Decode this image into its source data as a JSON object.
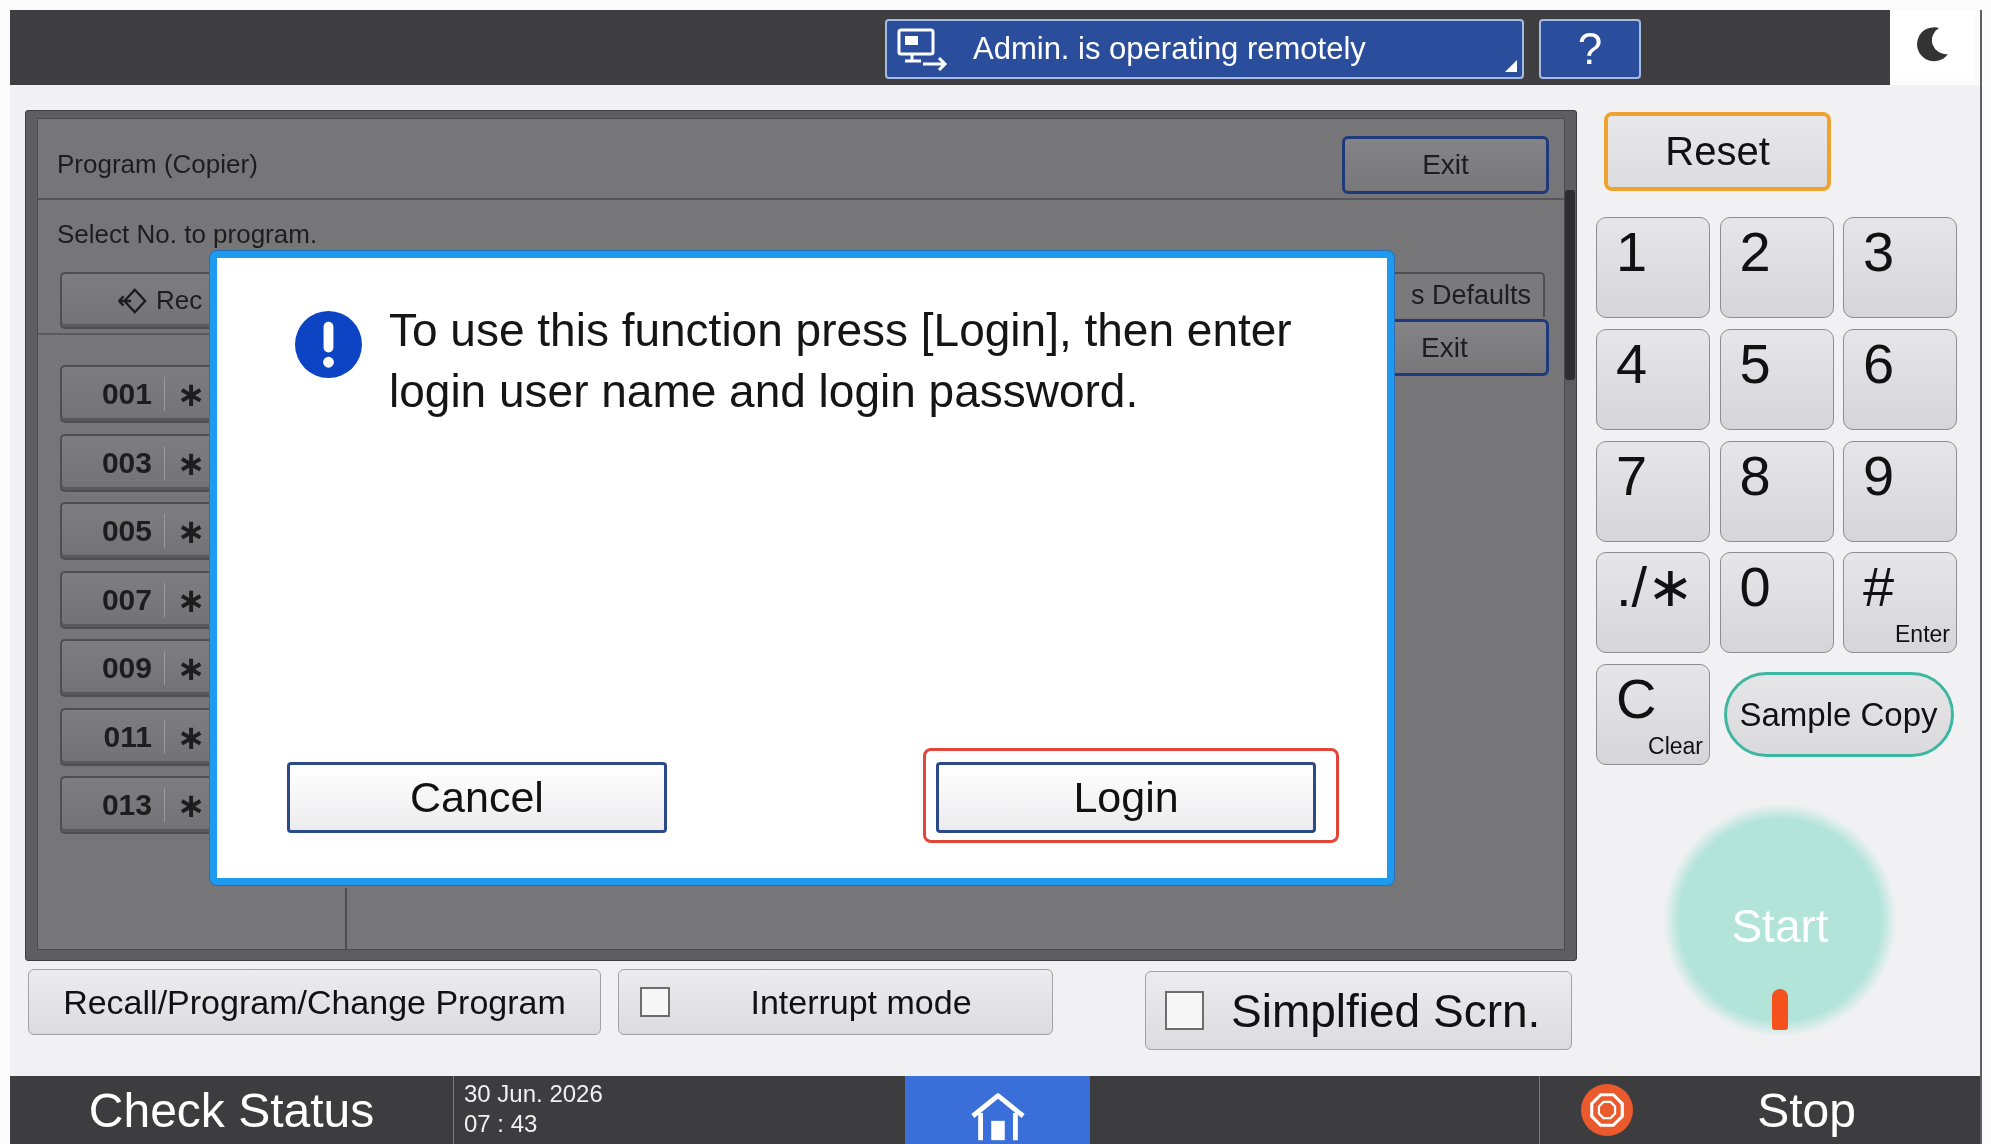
{
  "top_bar": {
    "remote_status": "Admin. is operating remotely",
    "help": "?"
  },
  "program_window": {
    "title": "Program (Copier)",
    "exit": "Exit",
    "instruction": "Select No. to program.",
    "recall": "Rec",
    "defaults": "s Defaults",
    "back_exit": "Exit",
    "programs": [
      {
        "number": "001",
        "symbol": "∗"
      },
      {
        "number": "003",
        "symbol": "∗"
      },
      {
        "number": "005",
        "symbol": "∗"
      },
      {
        "number": "007",
        "symbol": "∗"
      },
      {
        "number": "009",
        "symbol": "∗"
      },
      {
        "number": "011",
        "symbol": "∗"
      },
      {
        "number": "013",
        "symbol": "∗"
      }
    ]
  },
  "dialog": {
    "message": "To use this function press [Login], then enter login user name and login password.",
    "buttons": [
      {
        "label": "Cancel",
        "highlighted": false
      },
      {
        "label": "Login",
        "highlighted": true
      }
    ]
  },
  "keypad": {
    "reset": "Reset",
    "keys": [
      {
        "label": "1"
      },
      {
        "label": "2"
      },
      {
        "label": "3"
      },
      {
        "label": "4"
      },
      {
        "label": "5"
      },
      {
        "label": "6"
      },
      {
        "label": "7"
      },
      {
        "label": "8"
      },
      {
        "label": "9"
      },
      {
        "label": "./∗"
      },
      {
        "label": "0"
      },
      {
        "label": "#",
        "sub": "Enter"
      },
      {
        "label": "C",
        "sub": "Clear"
      }
    ],
    "sample_copy": "Sample Copy",
    "start": {
      "label": "Start",
      "enabled": false
    }
  },
  "function_buttons": [
    {
      "kind": "plain",
      "label": "Recall/Program/Change Program"
    },
    {
      "kind": "checkbox",
      "label": "Interrupt mode",
      "checked": false
    },
    {
      "kind": "checkbox",
      "label": "Simplfied Scrn.",
      "checked": false
    }
  ],
  "status_bar": {
    "check_status": "Check Status",
    "date": "30 Jun. 2026",
    "time": "07 : 43",
    "stop": "Stop"
  }
}
